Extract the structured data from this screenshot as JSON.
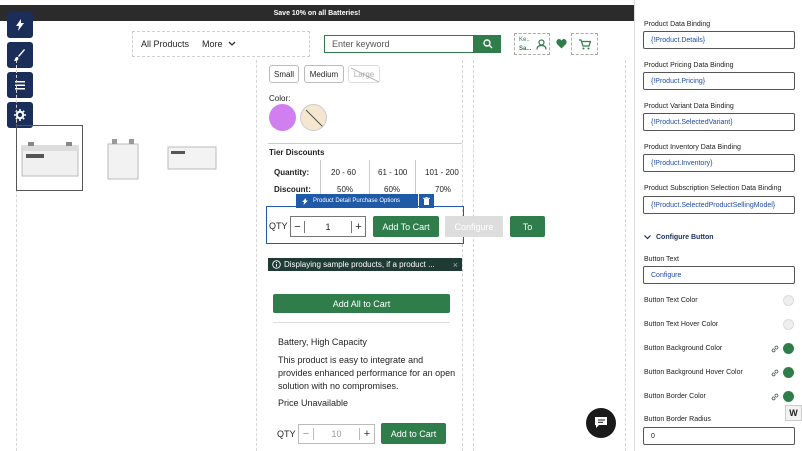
{
  "banner": {
    "text": "Save 10% on all Batteries!"
  },
  "nav": {
    "all_products": "All Products",
    "more": "More"
  },
  "search": {
    "placeholder": "Enter keyword"
  },
  "account": {
    "line1": "Ke..",
    "line2": "Sa..."
  },
  "sizes": [
    "Small",
    "Medium",
    "Large"
  ],
  "color_label": "Color:",
  "colors": {
    "swatch1": "#d17ff0",
    "swatch2": "#f4e6cf"
  },
  "tier": {
    "title": "Tier Discounts",
    "quantity_label": "Quantity:",
    "discount_label": "Discount:",
    "quantities": [
      "20 - 60",
      "61 - 100",
      "101 - 200"
    ],
    "discounts": [
      "50%",
      "60%",
      "70%"
    ]
  },
  "purchase": {
    "tag": "Product Detail Purchase Options",
    "qty_label": "QTY",
    "qty_value": "1",
    "add_to_cart": "Add To Cart",
    "configure": "Configure",
    "to": "To"
  },
  "notice": {
    "text": "Displaying sample products, if a product ..."
  },
  "add_all": "Add All to Cart",
  "product": {
    "name": "Battery, High Capacity",
    "description": "This product is easy to integrate and provides enhanced performance for an open solution with no compromises.",
    "price": "Price Unavailable",
    "qty_label": "QTY",
    "qty_value": "10",
    "add_to_cart": "Add to Cart"
  },
  "panel": {
    "bindings": [
      {
        "label": "Product Data Binding",
        "value": "{!Product.Details}"
      },
      {
        "label": "Product Pricing Data Binding",
        "value": "{!Product.Pricing}"
      },
      {
        "label": "Product Variant Data Binding",
        "value": "{!Product.SelectedVariant}"
      },
      {
        "label": "Product Inventory Data Binding",
        "value": "{!Product.Inventory}"
      },
      {
        "label": "Product Subscription Selection Data Binding",
        "value": "{!Product.SelectedProductSellingModel}"
      }
    ],
    "section_title": "Configure Button",
    "button_text_label": "Button Text",
    "button_text_value": "Configure",
    "colors": [
      {
        "label": "Button Text Color",
        "swatch": "#eeeeee"
      },
      {
        "label": "Button Text Hover Color",
        "swatch": "#eeeeee"
      },
      {
        "label": "Button Background Color",
        "swatch": "#2f7d4a"
      },
      {
        "label": "Button Background Hover Color",
        "swatch": "#2f7d4a"
      },
      {
        "label": "Button Border Color",
        "swatch": "#2f7d4a"
      }
    ],
    "radius_label": "Button Border Radius",
    "radius_value": "0"
  }
}
